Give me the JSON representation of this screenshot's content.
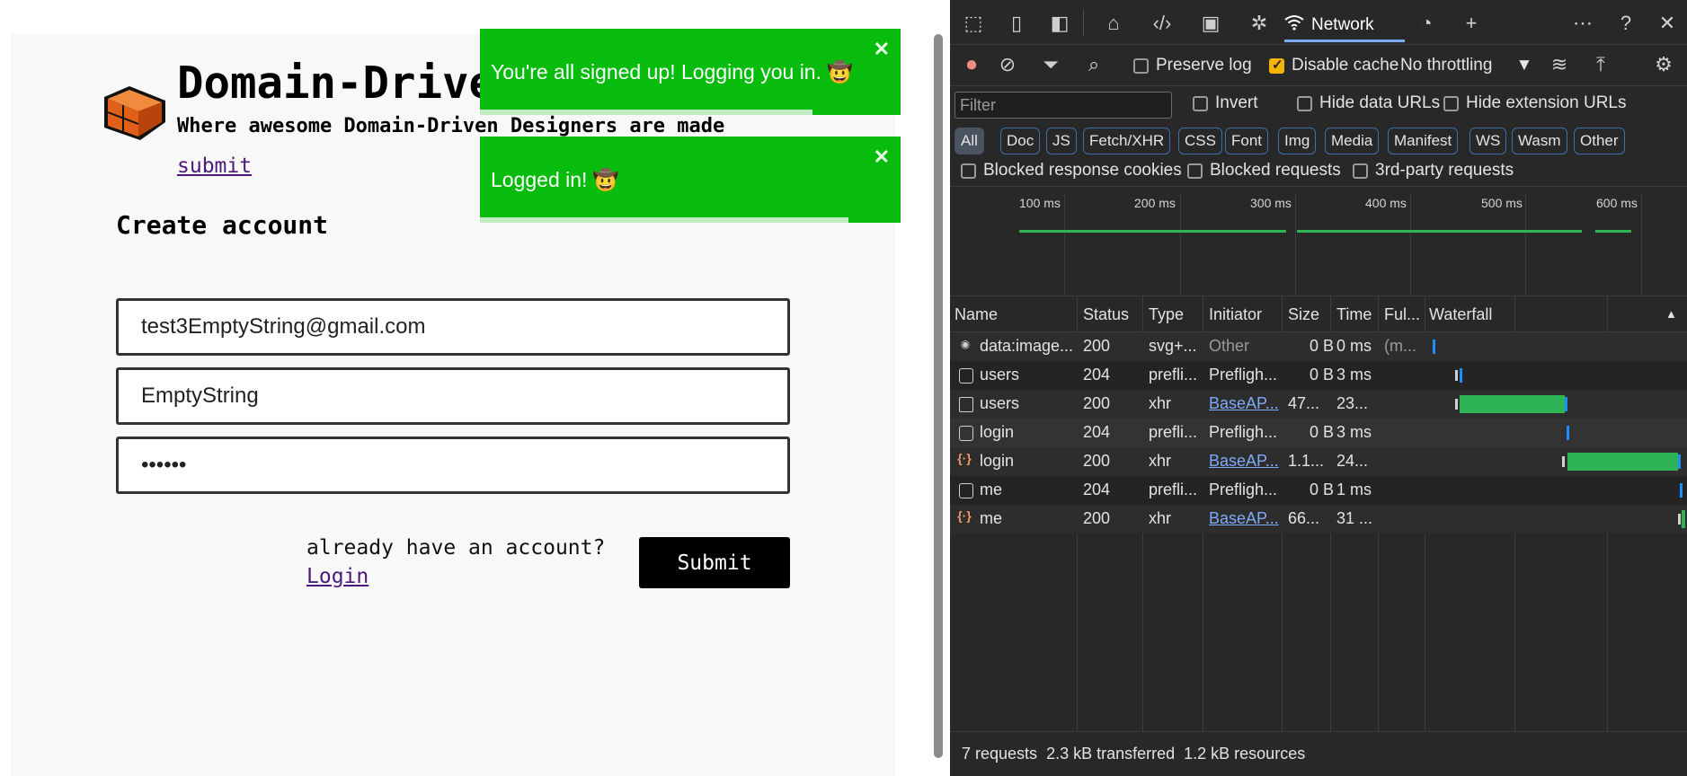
{
  "page": {
    "brand_title": "Domain-Drive",
    "brand_subtitle": "Where awesome Domain-Driven Designers are made",
    "submit_link": "submit",
    "heading": "Create account",
    "email_value": "test3EmptyString@gmail.com",
    "username_value": "EmptyString",
    "password_value": "••••••",
    "already_text": "already have an account?",
    "login_link": "Login",
    "submit_button": "Submit"
  },
  "toasts": [
    {
      "message": "You're all signed up! Logging you in. 🤠",
      "close": "✕"
    },
    {
      "message": "Logged in! 🤠",
      "close": "✕"
    }
  ],
  "devtools": {
    "tab_label": "Network",
    "toolbar": {
      "preserve_log": "Preserve log",
      "disable_cache": "Disable cache",
      "throttling": "No throttling"
    },
    "filter": {
      "placeholder": "Filter",
      "invert": "Invert",
      "hide_data_urls": "Hide data URLs",
      "hide_extension_urls": "Hide extension URLs",
      "blocked_response_cookies": "Blocked response cookies",
      "blocked_requests": "Blocked requests",
      "third_party": "3rd-party requests",
      "chips": [
        "All",
        "Doc",
        "JS",
        "Fetch/XHR",
        "CSS",
        "Font",
        "Img",
        "Media",
        "Manifest",
        "WS",
        "Wasm",
        "Other"
      ]
    },
    "timeline_ticks": [
      "100 ms",
      "200 ms",
      "300 ms",
      "400 ms",
      "500 ms",
      "600 ms"
    ],
    "columns": [
      "Name",
      "Status",
      "Type",
      "Initiator",
      "Size",
      "Time",
      "Ful...",
      "Waterfall"
    ],
    "rows": [
      {
        "name": "data:image...",
        "status": "200",
        "type": "svg+...",
        "initiator": "Other",
        "size": "0 B",
        "time": "0 ms",
        "full": "(m..."
      },
      {
        "name": "users",
        "status": "204",
        "type": "prefli...",
        "initiator": "Prefligh...",
        "size": "0 B",
        "time": "3 ms",
        "full": ""
      },
      {
        "name": "users",
        "status": "200",
        "type": "xhr",
        "initiator": "BaseAP...",
        "size": "47...",
        "time": "23...",
        "full": ""
      },
      {
        "name": "login",
        "status": "204",
        "type": "prefli...",
        "initiator": "Prefligh...",
        "size": "0 B",
        "time": "3 ms",
        "full": ""
      },
      {
        "name": "login",
        "status": "200",
        "type": "xhr",
        "initiator": "BaseAP...",
        "size": "1.1...",
        "time": "24...",
        "full": ""
      },
      {
        "name": "me",
        "status": "204",
        "type": "prefli...",
        "initiator": "Prefligh...",
        "size": "0 B",
        "time": "1 ms",
        "full": ""
      },
      {
        "name": "me",
        "status": "200",
        "type": "xhr",
        "initiator": "BaseAP...",
        "size": "66...",
        "time": "31 ...",
        "full": ""
      }
    ],
    "status_bar": {
      "requests": "7 requests",
      "transferred": "2.3 kB transferred",
      "resources": "1.2 kB resources"
    }
  }
}
